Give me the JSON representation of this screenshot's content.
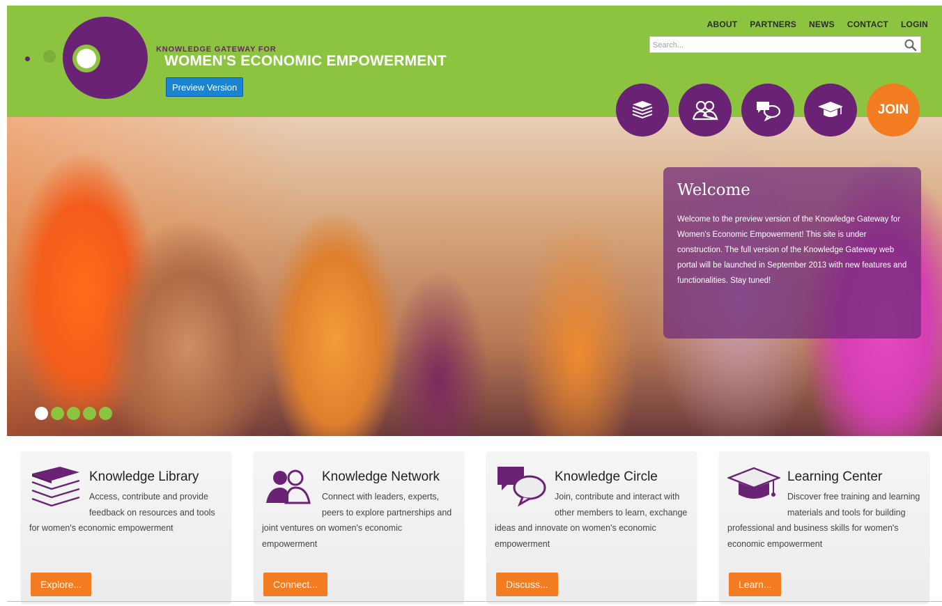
{
  "brand": {
    "tagline_top": "KNOWLEDGE GATEWAY FOR",
    "name": "WOMEN'S ECONOMIC EMPOWERMENT",
    "preview_label": "Preview Version"
  },
  "topnav": {
    "items": [
      "ABOUT",
      "PARTNERS",
      "NEWS",
      "CONTACT",
      "LOGIN"
    ]
  },
  "search": {
    "placeholder": "Search..."
  },
  "circle_nav": {
    "join_label": "JOIN",
    "icons": [
      "books-icon",
      "people-icon",
      "chat-bubbles-icon",
      "graduation-cap-icon"
    ]
  },
  "hero": {
    "welcome_title": "Welcome",
    "welcome_text": "Welcome to the preview version of the Knowledge Gateway for Women's Economic Empowerment! This site is under construction. The full version of the Knowledge Gateway web portal will be launched in September 2013 with new features and functionalities. Stay tuned!",
    "slide_count": 5,
    "active_slide": 1
  },
  "cards": [
    {
      "title": "Knowledge Library",
      "description": "Access, contribute and provide feedback on resources and tools for women's economic empowerment",
      "button": "Explore...",
      "icon": "books-icon"
    },
    {
      "title": "Knowledge Network",
      "description": "Connect with leaders, experts, peers to explore partnerships and joint ventures on women's economic empowerment",
      "button": "Connect...",
      "icon": "people-icon"
    },
    {
      "title": "Knowledge Circle",
      "description": "Join, contribute and interact with other members to learn, exchange ideas and innovate on women's economic empowerment",
      "button": "Discuss...",
      "icon": "chat-bubbles-icon"
    },
    {
      "title": "Learning Center",
      "description": "Discover free training and learning materials and tools for building professional and business skills for women's economic empowerment",
      "button": "Learn...",
      "icon": "graduation-cap-icon"
    }
  ],
  "colors": {
    "header_green": "#8cc43f",
    "brand_purple": "#6a2274",
    "accent_orange": "#f47c20",
    "preview_blue": "#1a84d0"
  }
}
